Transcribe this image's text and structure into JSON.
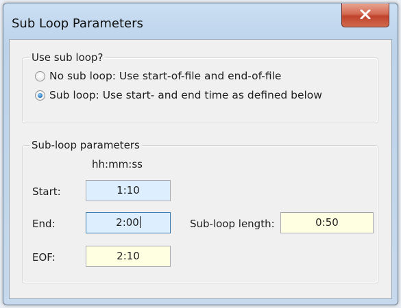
{
  "window": {
    "title": "Sub Loop Parameters",
    "close_icon": "close-x-icon"
  },
  "use_group": {
    "label": "Use sub loop?",
    "options": [
      {
        "label": "No sub loop: Use start-of-file and end-of-file",
        "checked": false
      },
      {
        "label": "Sub loop: Use start- and end time as defined below",
        "checked": true
      }
    ]
  },
  "params_group": {
    "label": "Sub-loop parameters",
    "format_hint": "hh:mm:ss",
    "start": {
      "label": "Start:",
      "value": "1:10"
    },
    "end": {
      "label": "End:",
      "value": "2:00"
    },
    "length": {
      "label": "Sub-loop length:",
      "value": "0:50"
    },
    "eof": {
      "label": "EOF:",
      "value": "2:10"
    }
  },
  "colors": {
    "editable_field": "#ddefff",
    "readonly_field": "#ffffe1",
    "close_button": "#c74a33"
  }
}
